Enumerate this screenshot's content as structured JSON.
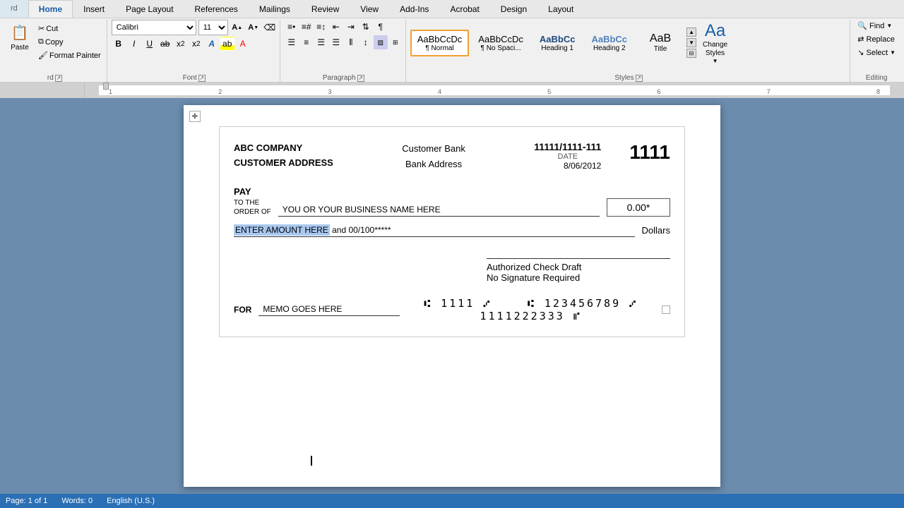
{
  "ribbon": {
    "tabs": [
      "rd",
      "Home",
      "Insert",
      "Page Layout",
      "References",
      "Mailings",
      "Review",
      "View",
      "Add-Ins",
      "Acrobat",
      "Design",
      "Layout"
    ],
    "active_tab": "Home",
    "groups": {
      "clipboard": {
        "label": "rd",
        "paste": "Paste",
        "cut": "Cut",
        "copy": "Copy",
        "format_painter": "Format Painter"
      },
      "font": {
        "label": "Font",
        "font_name": "Calibri",
        "font_size": "11",
        "bold": "B",
        "italic": "I",
        "underline": "U",
        "strikethrough": "abc",
        "subscript": "x₂",
        "superscript": "x²",
        "text_effects": "A",
        "highlight": "ab",
        "font_color": "A"
      },
      "paragraph": {
        "label": "Paragraph"
      },
      "styles": {
        "label": "Styles",
        "items": [
          {
            "id": "normal",
            "label": "AaBbCcDc",
            "sublabel": "¶ Normal",
            "active": true
          },
          {
            "id": "no_spacing",
            "label": "AaBbCcDc",
            "sublabel": "¶ No Spaci...",
            "active": false
          },
          {
            "id": "heading1",
            "label": "AaBbCc",
            "sublabel": "Heading 1",
            "active": false
          },
          {
            "id": "heading2",
            "label": "AaBbCc",
            "sublabel": "Heading 2",
            "active": false
          },
          {
            "id": "title",
            "label": "AaB",
            "sublabel": "Title",
            "active": false
          }
        ],
        "change_styles_label": "Change\nStyles"
      },
      "editing": {
        "label": "Editing",
        "find": "Find",
        "replace": "Replace",
        "select": "Select"
      }
    }
  },
  "document": {
    "company_name": "ABC COMPANY",
    "company_address": "CUSTOMER ADDRESS",
    "bank_name": "Customer Bank",
    "bank_address": "Bank Address",
    "routing_number": "11111/1111-111",
    "date_label": "DATE",
    "date_value": "8/06/2012",
    "check_number": "1111",
    "pay_label_line1": "PAY",
    "pay_label_line2": "TO THE",
    "pay_label_line3": "ORDER OF",
    "payee": "YOU OR YOUR BUSINESS NAME HERE",
    "amount": "0.00*",
    "amount_words_selected": "ENTER AMOUNT HERE",
    "amount_words_rest": " and 00/100*****",
    "dollars_label": "Dollars",
    "authorized_line1": "Authorized Check Draft",
    "authorized_line2": "No Signature Required",
    "for_label": "FOR",
    "memo": "MEMO GOES HERE",
    "micr_left": "⑆ 1111 ⑇",
    "micr_mid": "⑆ 123456789 ⑇",
    "micr_right": "1111222333 ⑈"
  },
  "status_bar": {
    "page": "Page: 1 of 1",
    "words": "Words: 0",
    "language": "English (U.S.)"
  }
}
